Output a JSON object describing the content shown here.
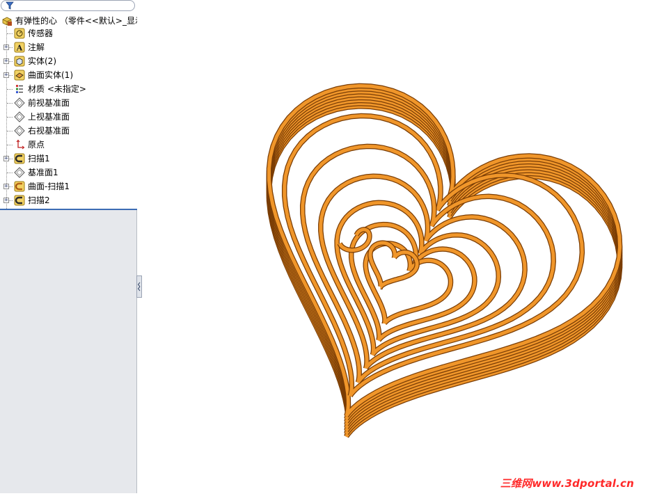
{
  "feature_tree": {
    "root": {
      "label": "有弹性的心 （零件<<默认>_显示",
      "icon": "part-icon"
    },
    "items": [
      {
        "label": "传感器",
        "icon": "sensor-icon",
        "expandable": false
      },
      {
        "label": "注解",
        "icon": "annotation-icon",
        "expandable": true
      },
      {
        "label": "实体(2)",
        "icon": "solid-bodies-icon",
        "expandable": true
      },
      {
        "label": "曲面实体(1)",
        "icon": "surface-bodies-icon",
        "expandable": true
      },
      {
        "label": "材质 <未指定>",
        "icon": "material-icon",
        "expandable": false
      },
      {
        "label": "前视基准面",
        "icon": "plane-icon",
        "expandable": false
      },
      {
        "label": "上视基准面",
        "icon": "plane-icon",
        "expandable": false
      },
      {
        "label": "右视基准面",
        "icon": "plane-icon",
        "expandable": false
      },
      {
        "label": "原点",
        "icon": "origin-icon",
        "expandable": false
      },
      {
        "label": "扫描1",
        "icon": "sweep-icon",
        "expandable": true
      },
      {
        "label": "基准面1",
        "icon": "plane-icon",
        "expandable": false
      },
      {
        "label": "曲面-扫描1",
        "icon": "surface-sweep-icon",
        "expandable": true
      },
      {
        "label": "扫描2",
        "icon": "sweep-icon",
        "expandable": true
      }
    ],
    "expand_symbol": "+"
  },
  "graphics": {
    "model": "spring-heart-icon",
    "tube_color": "#f0962a",
    "tube_shadow": "#7a3d05"
  },
  "watermark": "三维网www.3dportal.cn",
  "colors": {
    "panel_bg": "#e6e8ec",
    "separator": "#3c6cb4",
    "watermark": "#ff2a2a"
  }
}
